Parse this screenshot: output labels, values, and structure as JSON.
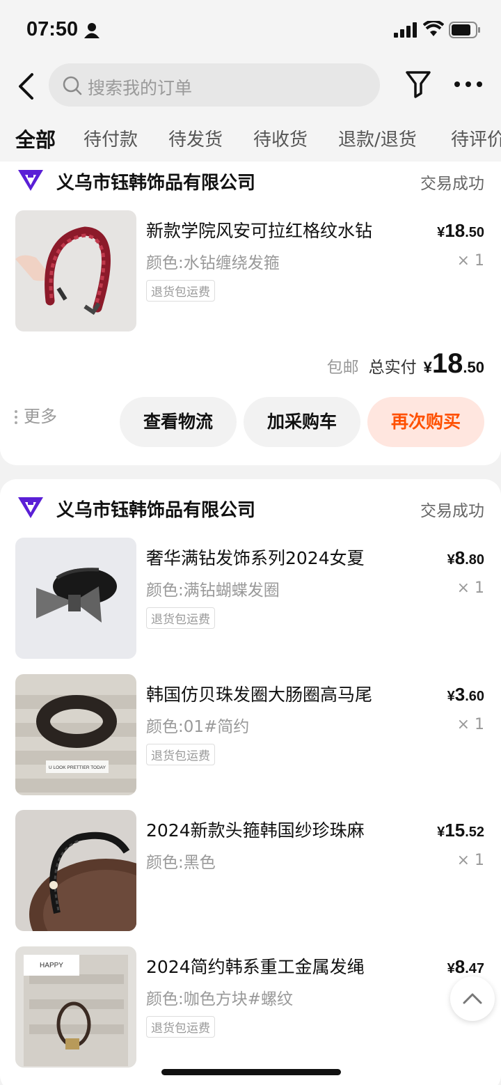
{
  "status_bar": {
    "time": "07:50"
  },
  "search": {
    "placeholder": "搜索我的订单"
  },
  "tabs": [
    "全部",
    "待付款",
    "待发货",
    "待收货",
    "退款/退货",
    "待评价"
  ],
  "colors": {
    "accent": "#ff5000",
    "accent_bg": "#ffe6df",
    "shop_logo": "#5a1fd6"
  },
  "orders": [
    {
      "shop_name": "义乌市钰韩饰品有限公司",
      "status": "交易成功",
      "items": [
        {
          "title": "新款学院风安可拉红格纹水钻",
          "spec": "颜色:水钻缠绕发箍",
          "tag": "退货包运费",
          "price_currency": "¥",
          "price_int": "18",
          "price_dec": ".50",
          "qty": "× 1"
        }
      ],
      "free_shipping": "包邮",
      "total_label": "总实付",
      "total_currency": "¥",
      "total_int": "18",
      "total_dec": ".50",
      "more": "更多",
      "buttons": [
        "查看物流",
        "加采购车",
        "再次购买"
      ]
    },
    {
      "shop_name": "义乌市钰韩饰品有限公司",
      "status": "交易成功",
      "items": [
        {
          "title": "奢华满钻发饰系列2024女夏",
          "spec": "颜色:满钻蝴蝶发圈",
          "tag": "退货包运费",
          "price_currency": "¥",
          "price_int": "8",
          "price_dec": ".80",
          "qty": "× 1"
        },
        {
          "title": "韩国仿贝珠发圈大肠圈高马尾",
          "spec": "颜色:01#简约",
          "tag": "退货包运费",
          "price_currency": "¥",
          "price_int": "3",
          "price_dec": ".60",
          "qty": "× 1",
          "image_caption": "U LOOK PRETTIER TODAY"
        },
        {
          "title": "2024新款头箍韩国纱珍珠麻",
          "spec": "颜色:黑色",
          "price_currency": "¥",
          "price_int": "15",
          "price_dec": ".52",
          "qty": "× 1"
        },
        {
          "title": "2024简约韩系重工金属发绳",
          "spec": "颜色:咖色方块#螺纹",
          "tag": "退货包运费",
          "price_currency": "¥",
          "price_int": "8",
          "price_dec": ".47",
          "image_caption": "HAPPY"
        }
      ]
    }
  ]
}
